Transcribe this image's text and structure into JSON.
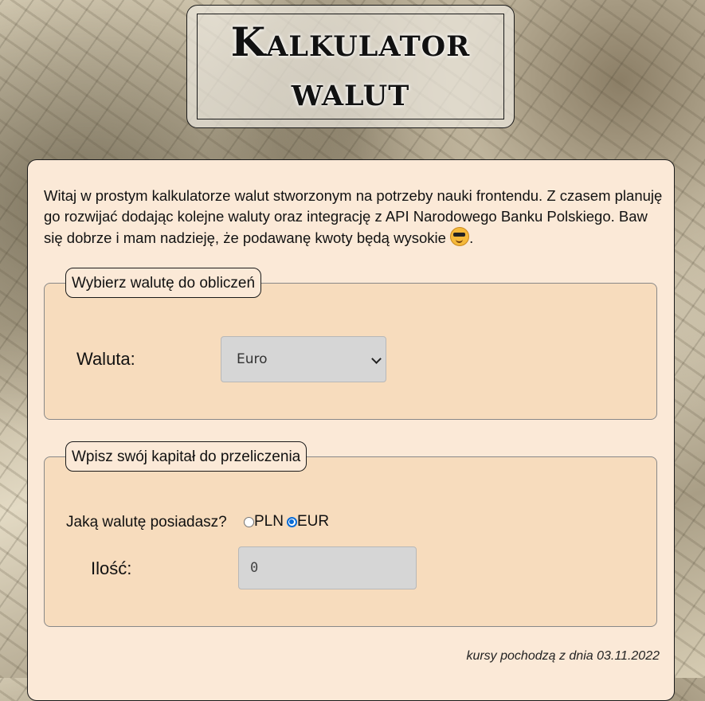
{
  "header": {
    "title_line1": "Kalkulator",
    "title_line2": "walut"
  },
  "intro": {
    "text": "Witaj w prostym kalkulatorze walut stworzonym na potrzeby nauki frontendu. Z czasem planuję go rozwijać dodając kolejne waluty oraz integrację z API Narodowego Banku Polskiego. Baw się dobrze i mam nadzieję, że podawanę kwoty będą wysokie ",
    "suffix": ".",
    "emoji_icon": "smiling-face-with-sunglasses-icon"
  },
  "currency_section": {
    "legend": "Wybierz walutę do obliczeń",
    "label": "Waluta:",
    "selected": "Euro"
  },
  "capital_section": {
    "legend": "Wpisz swój kapitał do przeliczenia",
    "have_label": "Jaką walutę posiadasz?",
    "options": [
      {
        "label": "PLN",
        "checked": false
      },
      {
        "label": "EUR",
        "checked": true
      }
    ],
    "amount_label": "Ilość:",
    "amount_placeholder": "0"
  },
  "footnote": "kursy pochodzą z dnia 03.11.2022",
  "colors": {
    "card_bg": "#fbe9d7",
    "fieldset_bg": "#f7dcbd",
    "input_bg": "#d6d6d6",
    "radio_accent": "#0a6cd6"
  }
}
